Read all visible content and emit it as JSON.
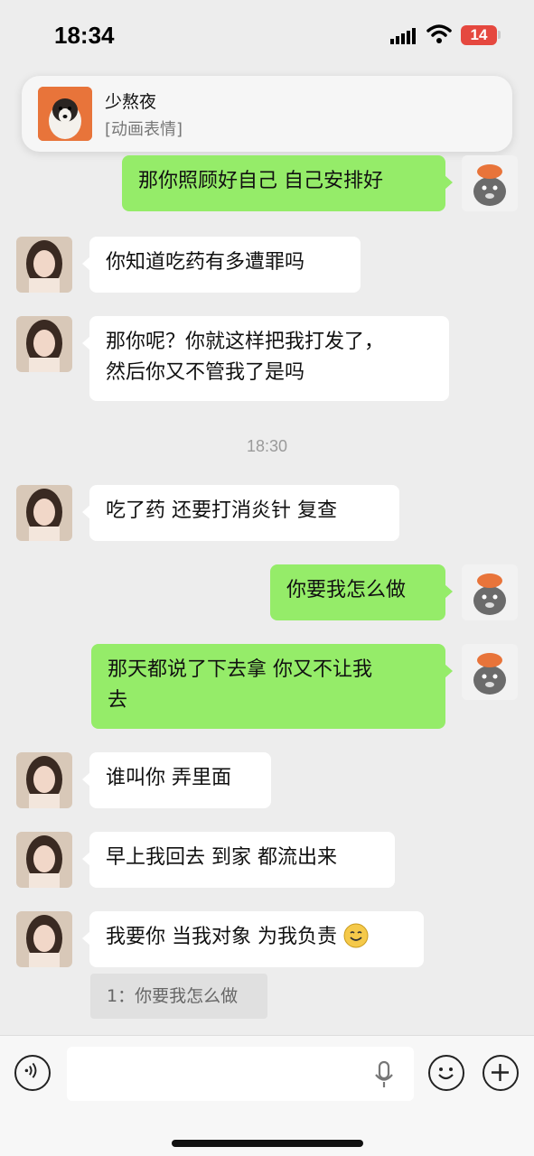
{
  "status_bar": {
    "time": "18:34",
    "battery": "14"
  },
  "notification": {
    "title": "少熬夜",
    "body": "[动画表情]"
  },
  "messages": [
    {
      "side": "right",
      "text": "那你照顾好自己 自己安排好"
    },
    {
      "side": "left",
      "text": "你知道吃药有多遭罪吗"
    },
    {
      "side": "left",
      "line1": "那你呢？你就这样把我打发了，",
      "line2": "然后你又不管我了是吗"
    },
    {
      "side": "left",
      "text": "吃了药 还要打消炎针 复查"
    },
    {
      "side": "right",
      "text": "你要我怎么做"
    },
    {
      "side": "right",
      "line1": "那天都说了下去拿 你又不让我",
      "line2": "去"
    },
    {
      "side": "left",
      "text": "谁叫你 弄里面"
    },
    {
      "side": "left",
      "text": "早上我回去 到家 都流出来"
    },
    {
      "side": "left",
      "text": "我要你 当我对象 为我负责"
    }
  ],
  "timestamp": "18:30",
  "quote": "1：你要我怎么做",
  "colors": {
    "sent_bubble": "#95ec69",
    "received_bubble": "#ffffff",
    "background": "#ededed"
  },
  "icons": [
    "signal-icon",
    "wifi-icon",
    "voice-icon",
    "microphone-icon",
    "emoji-icon",
    "plus-icon",
    "smile-emoji"
  ]
}
